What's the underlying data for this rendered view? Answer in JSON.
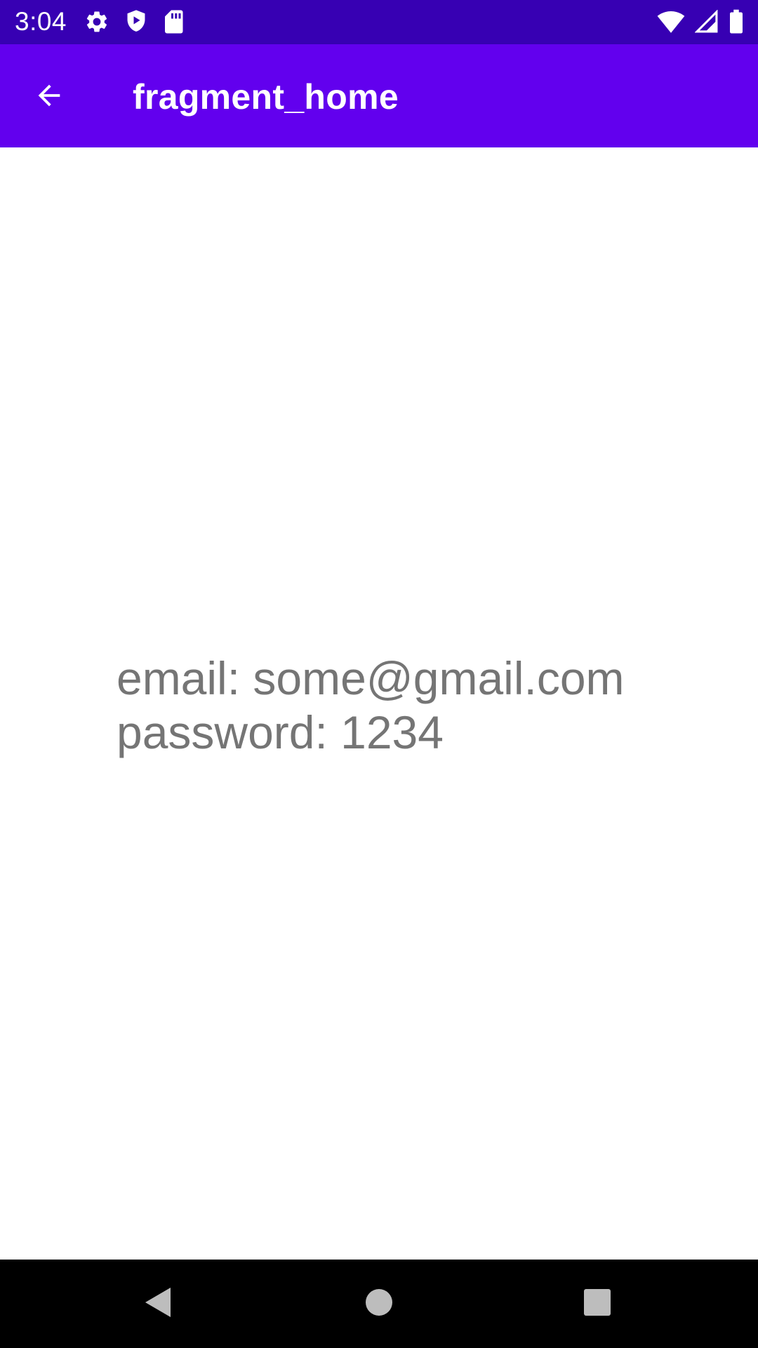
{
  "status_bar": {
    "time": "3:04",
    "left_icons": [
      "settings-icon",
      "shield-play-icon",
      "sd-card-icon"
    ],
    "right_icons": [
      "wifi-icon",
      "cell-signal-icon",
      "battery-icon"
    ],
    "background_color": "#3700B3"
  },
  "app_bar": {
    "title": "fragment_home",
    "back_icon": "arrow-back-icon",
    "background_color": "#6200EE"
  },
  "content": {
    "email_line": "email: some@gmail.com",
    "password_line": "password: 1234",
    "text_color": "#757575"
  },
  "nav_bar": {
    "buttons": [
      "back-triangle-icon",
      "home-circle-icon",
      "recents-square-icon"
    ]
  }
}
